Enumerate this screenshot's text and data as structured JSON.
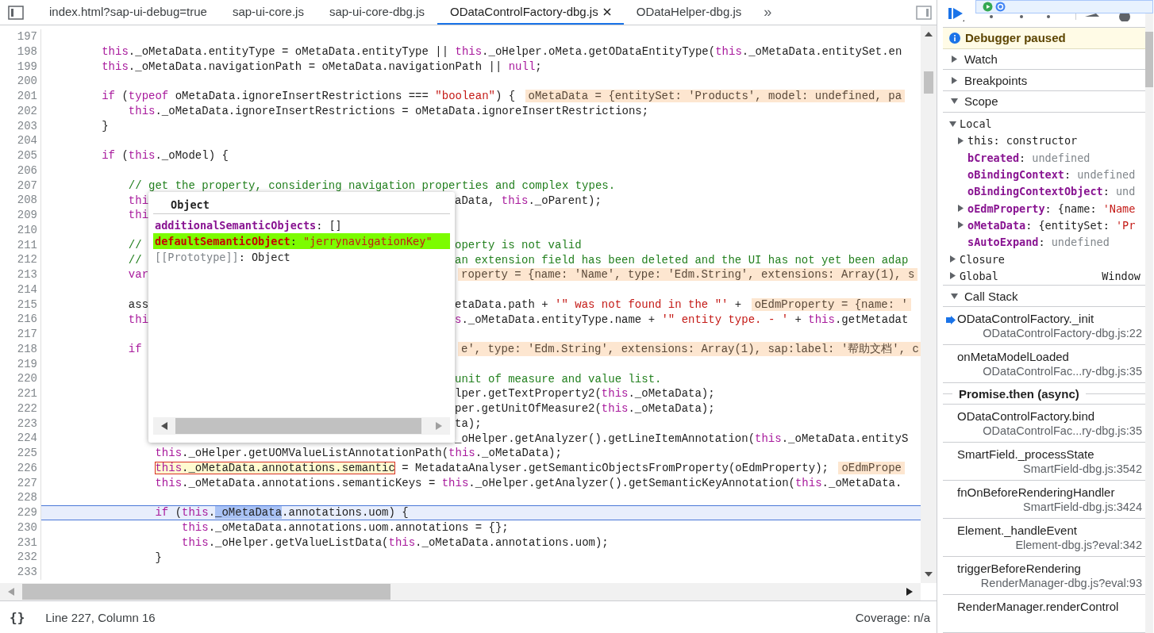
{
  "tabs": [
    {
      "label": "index.html?sap-ui-debug=true",
      "selected": false,
      "closable": false
    },
    {
      "label": "sap-ui-core.js",
      "selected": false,
      "closable": false
    },
    {
      "label": "sap-ui-core-dbg.js",
      "selected": false,
      "closable": false
    },
    {
      "label": "ODataControlFactory-dbg.js",
      "selected": true,
      "closable": true
    },
    {
      "label": "ODataHelper-dbg.js",
      "selected": false,
      "closable": false
    }
  ],
  "more_tabs": "»",
  "editor": {
    "lines": [
      {
        "number": "197"
      },
      {
        "number": "198",
        "code": [
          {
            "kind": "keyword",
            "text": "        this"
          },
          {
            "kind": "plain",
            "text": "._oMetaData.entityType = oMetaData.entityType || "
          },
          {
            "kind": "keyword",
            "text": "this"
          },
          {
            "kind": "plain",
            "text": "._oHelper.oMeta.getODataEntityType("
          },
          {
            "kind": "keyword",
            "text": "this"
          },
          {
            "kind": "plain",
            "text": "._oMetaData.entitySet.en"
          }
        ]
      },
      {
        "number": "199",
        "code": [
          {
            "kind": "keyword",
            "text": "        this"
          },
          {
            "kind": "plain",
            "text": "._oMetaData.navigationPath = oMetaData.navigationPath || "
          },
          {
            "kind": "keyword",
            "text": "null"
          },
          {
            "kind": "plain",
            "text": ";"
          }
        ]
      },
      {
        "number": "200"
      },
      {
        "number": "201",
        "code": [
          {
            "kind": "keyword",
            "text": "        if"
          },
          {
            "kind": "plain",
            "text": " ("
          },
          {
            "kind": "keyword",
            "text": "typeof"
          },
          {
            "kind": "plain",
            "text": " oMetaData.ignoreInsertRestrictions === "
          },
          {
            "kind": "string",
            "text": "\"boolean\""
          },
          {
            "kind": "plain",
            "text": ") { "
          },
          {
            "kind": "value",
            "text": "oMetaData = {entitySet: 'Products', model: undefined, pa"
          }
        ]
      },
      {
        "number": "202",
        "code": [
          {
            "kind": "keyword",
            "text": "            this"
          },
          {
            "kind": "plain",
            "text": "._oMetaData.ignoreInsertRestrictions = oMetaData.ignoreInsertRestrictions;"
          }
        ]
      },
      {
        "number": "203",
        "code": [
          {
            "kind": "plain",
            "text": "        }"
          }
        ]
      },
      {
        "number": "204"
      },
      {
        "number": "205",
        "code": [
          {
            "kind": "keyword",
            "text": "        if"
          },
          {
            "kind": "plain",
            "text": " ("
          },
          {
            "kind": "keyword",
            "text": "this"
          },
          {
            "kind": "plain",
            "text": "._oModel) {"
          }
        ]
      },
      {
        "number": "206"
      },
      {
        "number": "207",
        "code": [
          {
            "kind": "comment",
            "text": "            // get the property, considering navigation properties and complex types."
          }
        ]
      },
      {
        "number": "208",
        "code": [
          {
            "kind": "keyword",
            "text": "            thi"
          }
        ],
        "after": [
          {
            "kind": "plain",
            "text": "aData, "
          },
          {
            "kind": "keyword",
            "text": "this"
          },
          {
            "kind": "plain",
            "text": "._oParent);"
          }
        ]
      },
      {
        "number": "209",
        "code": [
          {
            "kind": "keyword",
            "text": "            thi"
          }
        ]
      },
      {
        "number": "210"
      },
      {
        "number": "211",
        "code": [
          {
            "kind": "comment",
            "text": "            //"
          }
        ],
        "after": [
          {
            "kind": "comment",
            "text": "operty is not valid"
          }
        ]
      },
      {
        "number": "212",
        "code": [
          {
            "kind": "comment",
            "text": "            //"
          }
        ],
        "after": [
          {
            "kind": "comment",
            "text": "an extension field has been deleted and the UI has not yet been adap"
          }
        ]
      },
      {
        "number": "213",
        "code": [
          {
            "kind": "keyword",
            "text": "            var"
          }
        ],
        "after": [
          {
            "kind": "value",
            "text": "roperty = {name: 'Name', type: 'Edm.String', extensions: Array(1), s"
          }
        ]
      },
      {
        "number": "214"
      },
      {
        "number": "215",
        "code": [
          {
            "kind": "plain",
            "text": "            ass"
          }
        ],
        "after": [
          {
            "kind": "plain",
            "text": "etaData.path + "
          },
          {
            "kind": "string",
            "text": "'\" was not found in the \"'"
          },
          {
            "kind": "plain",
            "text": " + "
          },
          {
            "kind": "value",
            "text": "oEdmProperty = {name: '"
          }
        ]
      },
      {
        "number": "216",
        "code": [
          {
            "kind": "keyword",
            "text": "            thi"
          }
        ],
        "after": [
          {
            "kind": "keyword",
            "text": "s"
          },
          {
            "kind": "plain",
            "text": "._oMetaData.entityType.name + "
          },
          {
            "kind": "string",
            "text": "'\" entity type. - '"
          },
          {
            "kind": "plain",
            "text": " + "
          },
          {
            "kind": "keyword",
            "text": "this"
          },
          {
            "kind": "plain",
            "text": ".getMetadat"
          }
        ]
      },
      {
        "number": "217"
      },
      {
        "number": "218",
        "code": [
          {
            "kind": "keyword",
            "text": "            if"
          }
        ],
        "after": [
          {
            "kind": "value",
            "text": "e', type: 'Edm.String', extensions: Array(1), sap:label: '帮助文档', c"
          }
        ]
      },
      {
        "number": "219"
      },
      {
        "number": "220",
        "after": [
          {
            "kind": "comment",
            "text": "unit of measure and value list."
          }
        ]
      },
      {
        "number": "221",
        "after": [
          {
            "kind": "plain",
            "text": "lper.getTextProperty2("
          },
          {
            "kind": "keyword",
            "text": "this"
          },
          {
            "kind": "plain",
            "text": "._oMetaData);"
          }
        ]
      },
      {
        "number": "222",
        "after": [
          {
            "kind": "plain",
            "text": "per.getUnitOfMeasure2("
          },
          {
            "kind": "keyword",
            "text": "this"
          },
          {
            "kind": "plain",
            "text": "._oMetaData);"
          }
        ]
      },
      {
        "number": "223",
        "after": [
          {
            "kind": "plain",
            "text": "ta);"
          }
        ]
      },
      {
        "number": "224",
        "after": [
          {
            "kind": "plain",
            "text": "_oHelper.getAnalyzer().getLineItemAnnotation("
          },
          {
            "kind": "keyword",
            "text": "this"
          },
          {
            "kind": "plain",
            "text": "._oMetaData.entityS"
          }
        ]
      },
      {
        "number": "225",
        "code": [
          {
            "kind": "keyword",
            "text": "                this"
          },
          {
            "kind": "plain",
            "text": "._oHelper.getUOMValueListAnnotationPath("
          },
          {
            "kind": "keyword",
            "text": "this"
          },
          {
            "kind": "plain",
            "text": "._oMetaData);"
          }
        ]
      },
      {
        "number": "226",
        "code": [
          {
            "kind": "hovered",
            "tokens": [
              {
                "kind": "keyword",
                "text": "                this"
              },
              {
                "kind": "plain",
                "text": "._oMetaData.annotations.semantic"
              }
            ]
          },
          {
            "kind": "plain",
            "text": " = MetadataAnalyser.getSemanticObjectsFromProperty(oEdmProperty); "
          },
          {
            "kind": "value",
            "text": "oEdmPrope"
          }
        ]
      },
      {
        "number": "227",
        "code": [
          {
            "kind": "keyword",
            "text": "                this"
          },
          {
            "kind": "plain",
            "text": "._oMetaData.annotations.semanticKeys = "
          },
          {
            "kind": "keyword",
            "text": "this"
          },
          {
            "kind": "plain",
            "text": "._oHelper.getAnalyzer().getSemanticKeyAnnotation("
          },
          {
            "kind": "keyword",
            "text": "this"
          },
          {
            "kind": "plain",
            "text": "._oMetaData."
          }
        ]
      },
      {
        "number": "228"
      },
      {
        "number": "229",
        "current": true,
        "code": [
          {
            "kind": "keyword",
            "text": "                if"
          },
          {
            "kind": "plain",
            "text": " ("
          },
          {
            "kind": "keyword",
            "text": "this"
          },
          {
            "kind": "plain",
            "text": "."
          },
          {
            "kind": "selection",
            "text": "_oMetaData"
          },
          {
            "kind": "plain",
            "text": ".annotations.uom) {"
          }
        ]
      },
      {
        "number": "230",
        "code": [
          {
            "kind": "keyword",
            "text": "                    this"
          },
          {
            "kind": "plain",
            "text": "._oMetaData.annotations.uom.annotations = {};"
          }
        ]
      },
      {
        "number": "231",
        "code": [
          {
            "kind": "keyword",
            "text": "                    this"
          },
          {
            "kind": "plain",
            "text": "._oHelper.getValueListData("
          },
          {
            "kind": "keyword",
            "text": "this"
          },
          {
            "kind": "plain",
            "text": "._oMetaData.annotations.uom);"
          }
        ]
      },
      {
        "number": "232",
        "code": [
          {
            "kind": "plain",
            "text": "                }"
          }
        ]
      },
      {
        "number": "233"
      }
    ]
  },
  "popover": {
    "title": "Object",
    "properties": [
      {
        "name": "additionalSemanticObjects",
        "kind": "own",
        "value": [
          {
            "kind": "plain",
            "text": ": []"
          }
        ],
        "highlighted": false
      },
      {
        "name": "defaultSemanticObject",
        "kind": "own",
        "value": [
          {
            "kind": "plain",
            "text": ": "
          },
          {
            "kind": "string",
            "text": "\"jerrynavigationKey\""
          }
        ],
        "highlighted": true
      },
      {
        "name": "[[Prototype]]",
        "kind": "internal",
        "value": [
          {
            "kind": "plain",
            "text": ": Object"
          }
        ],
        "highlighted": false
      }
    ]
  },
  "status_bar": {
    "pretty_print": "{}",
    "position": "Line 227, Column 16",
    "coverage": "Coverage: n/a"
  },
  "debugger": {
    "banner": "Debugger paused",
    "sections": [
      {
        "title": "Watch",
        "expanded": false
      },
      {
        "title": "Breakpoints",
        "expanded": false
      },
      {
        "kind": "scope",
        "title": "Scope",
        "expanded": true,
        "scopes": [
          {
            "name": "Local",
            "expanded": true,
            "variables": [
              {
                "name": "this",
                "emphasized": false,
                "expandable": true,
                "value": [
                  {
                    "kind": "plain",
                    "text": ": constructor"
                  }
                ]
              },
              {
                "name": "bCreated",
                "emphasized": true,
                "expandable": false,
                "value": [
                  {
                    "kind": "plain",
                    "text": ": "
                  },
                  {
                    "kind": "undefined",
                    "text": "undefined"
                  }
                ]
              },
              {
                "name": "oBindingContext",
                "emphasized": true,
                "expandable": false,
                "value": [
                  {
                    "kind": "plain",
                    "text": ": "
                  },
                  {
                    "kind": "undefined",
                    "text": "undefined"
                  }
                ]
              },
              {
                "name": "oBindingContextObject",
                "emphasized": true,
                "expandable": false,
                "value": [
                  {
                    "kind": "plain",
                    "text": ": "
                  },
                  {
                    "kind": "undefined",
                    "text": "und"
                  }
                ]
              },
              {
                "name": "oEdmProperty",
                "emphasized": true,
                "expandable": true,
                "value": [
                  {
                    "kind": "plain",
                    "text": ": {name: "
                  },
                  {
                    "kind": "string",
                    "text": "'Name"
                  }
                ]
              },
              {
                "name": "oMetaData",
                "emphasized": true,
                "expandable": true,
                "value": [
                  {
                    "kind": "plain",
                    "text": ": {entitySet: "
                  },
                  {
                    "kind": "string",
                    "text": "'Pr"
                  }
                ]
              },
              {
                "name": "sAutoExpand",
                "emphasized": true,
                "expandable": false,
                "value": [
                  {
                    "kind": "plain",
                    "text": ": "
                  },
                  {
                    "kind": "undefined",
                    "text": "undefined"
                  }
                ]
              }
            ]
          },
          {
            "name": "Closure",
            "expanded": false
          },
          {
            "name": "Global",
            "expanded": false,
            "value": "Window"
          }
        ]
      },
      {
        "kind": "callstack",
        "title": "Call Stack",
        "expanded": true,
        "frames": [
          {
            "kind": "frame",
            "name": "ODataControlFactory._init",
            "location": "ODataControlFactory-dbg.js:22",
            "current": true
          },
          {
            "kind": "frame",
            "name": "onMetaModelLoaded",
            "location": "ODataControlFac...ry-dbg.js:35",
            "current": false
          },
          {
            "kind": "async",
            "name": "Promise.then (async)"
          },
          {
            "kind": "frame",
            "name": "ODataControlFactory.bind",
            "location": "ODataControlFac...ry-dbg.js:35",
            "current": false
          },
          {
            "kind": "frame",
            "name": "SmartField._processState",
            "location": "SmartField-dbg.js:3542",
            "current": false
          },
          {
            "kind": "frame",
            "name": "fnOnBeforeRenderingHandler",
            "location": "SmartField-dbg.js:3424",
            "current": false
          },
          {
            "kind": "frame",
            "name": "Element._handleEvent",
            "location": "Element-dbg.js?eval:342",
            "current": false
          },
          {
            "kind": "frame",
            "name": "triggerBeforeRendering",
            "location": "RenderManager-dbg.js?eval:93",
            "current": false
          },
          {
            "kind": "frame",
            "name": "RenderManager.renderControl",
            "current": false
          }
        ]
      }
    ]
  }
}
